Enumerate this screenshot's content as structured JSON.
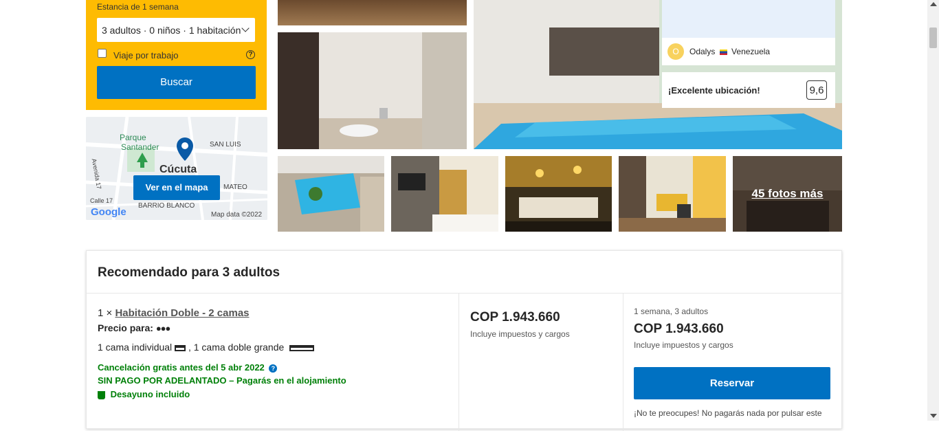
{
  "search": {
    "stay_label": "Estancia de 1 semana",
    "occupancy_value": "3 adultos · 0 niños · 1 habitación",
    "work_trip_label": "Viaje por trabajo",
    "help_icon": "?",
    "search_button": "Buscar"
  },
  "map": {
    "park_label_1": "Parque",
    "park_label_2": "Santander",
    "city_label": "Cúcuta",
    "san_luis_label": "SAN LUIS",
    "mateo_label": "MATEO",
    "avenida_label": "Avenida 17",
    "calle_label": "Calle 17",
    "barrio_label": "BARRIO BLANCO",
    "google_label": "Google",
    "map_data_label": "Map data ©2022",
    "view_map_button": "Ver en el mapa"
  },
  "gallery": {
    "more_photos": "45 fotos más"
  },
  "review": {
    "avatar_letter": "O",
    "reviewer_name": "Odalys",
    "country": "Venezuela"
  },
  "location_score": {
    "label": "¡Excelente ubicación!",
    "score": "9,6"
  },
  "recommendation": {
    "title": "Recomendado para 3 adultos",
    "room_count": "1 ×",
    "room_name": "Habitación Doble - 2 camas",
    "price_for_label": "Precio para:",
    "bed_single": "1 cama individual",
    "bed_double": ", 1 cama doble grande",
    "cancellation": "Cancelación gratis antes del 5 abr 2022",
    "no_prepayment": "SIN PAGO POR ADELANTADO – Pagarás en el alojamiento",
    "breakfast": "Desayuno incluido",
    "price": "COP 1.943.660",
    "taxes_note": "Incluye impuestos y cargos",
    "stay_summary": "1 semana, 3 adultos",
    "total_price": "COP 1.943.660",
    "total_taxes_note": "Incluye impuestos y cargos",
    "reserve_button": "Reservar",
    "no_worry_note": "¡No te preocupes! No pagarás nada por pulsar este"
  },
  "colors": {
    "brand_blue": "#0071c2",
    "search_yellow": "#febb02",
    "green": "#008009"
  }
}
